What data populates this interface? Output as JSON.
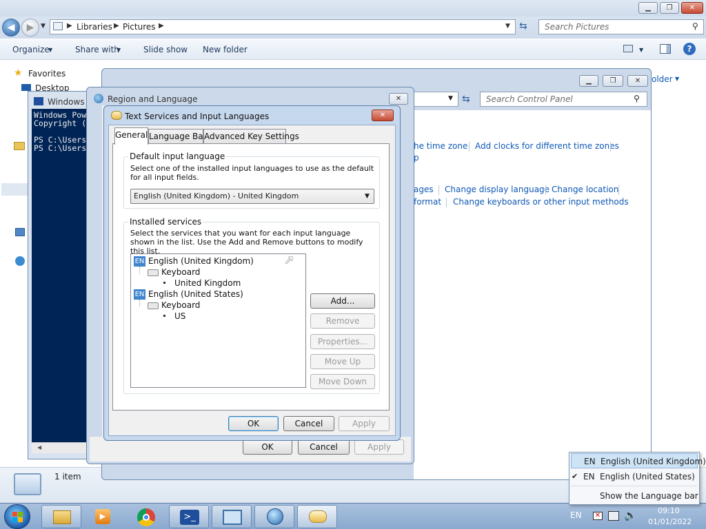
{
  "explorer": {
    "breadcrumb": [
      "Libraries",
      "Pictures"
    ],
    "search_placeholder": "Search Pictures",
    "toolbar": {
      "organize": "Organize",
      "share_with": "Share with",
      "slide_show": "Slide show",
      "new_folder": "New folder"
    },
    "nav": {
      "favorites": "Favorites",
      "desktop": "Desktop"
    },
    "status": "1 item",
    "partial_header": "older"
  },
  "control_panel": {
    "search_placeholder": "Search Control Panel",
    "links_row1": [
      "he time zone",
      "Add clocks for different time zones"
    ],
    "links_row1b": "p",
    "links_row2": [
      "ages",
      "Change display language",
      "Change location"
    ],
    "links_row3": [
      "format",
      "Change keyboards or other input methods"
    ]
  },
  "powershell": {
    "title": "Windows P",
    "lines": [
      "Windows Pow",
      "Copyright (",
      "",
      "PS C:\\Users",
      "PS C:\\Users"
    ]
  },
  "region_dialog": {
    "title": "Region and Language",
    "ok": "OK",
    "cancel": "Cancel",
    "apply": "Apply"
  },
  "text_services": {
    "title": "Text Services and Input Languages",
    "tabs": [
      "General",
      "Language Bar",
      "Advanced Key Settings"
    ],
    "default_group_label": "Default input language",
    "default_desc": "Select one of the installed input languages to use as the default for all input fields.",
    "default_value": "English (United Kingdom) - United Kingdom",
    "installed_group_label": "Installed services",
    "installed_desc": "Select the services that you want for each input language shown in the list. Use the Add and Remove buttons to modify this list.",
    "tree": [
      {
        "badge": "EN",
        "language": "English (United Kingdom)",
        "category": "Keyboard",
        "layout": "United Kingdom"
      },
      {
        "badge": "EN",
        "language": "English (United States)",
        "category": "Keyboard",
        "layout": "US"
      }
    ],
    "buttons": {
      "add": "Add...",
      "remove": "Remove",
      "properties": "Properties...",
      "move_up": "Move Up",
      "move_down": "Move Down"
    },
    "ok": "OK",
    "cancel": "Cancel",
    "apply": "Apply"
  },
  "language_menu": {
    "items": [
      {
        "code": "EN",
        "label": "English (United Kingdom)",
        "checked": false,
        "highlighted": true
      },
      {
        "code": "EN",
        "label": "English (United States)",
        "checked": true,
        "highlighted": false
      }
    ],
    "show_bar": "Show the Language bar"
  },
  "taskbar": {
    "lang_indicator": "EN",
    "time": "09:10",
    "date": "01/01/2022",
    "apps": [
      "explorer-icon",
      "media-player-icon",
      "chrome-icon",
      "powershell-icon",
      "control-panel-icon",
      "network-globe-icon",
      "text-services-icon"
    ]
  },
  "colors": {
    "link": "#0e58b5",
    "accent": "#3f85cd",
    "menu_highlight": "#cde4f7"
  }
}
